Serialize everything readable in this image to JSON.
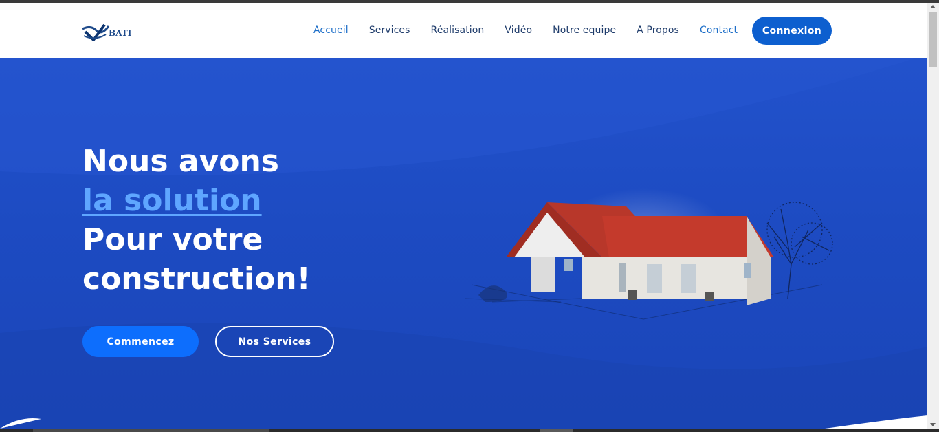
{
  "site": {
    "logo_text": "BATI",
    "logo_icon": "wave-v-logo"
  },
  "nav": {
    "items": [
      {
        "label": "Accueil",
        "active": true
      },
      {
        "label": "Services",
        "active": false
      },
      {
        "label": "Réalisation",
        "active": false
      },
      {
        "label": "Vidéo",
        "active": false
      },
      {
        "label": "Notre equipe",
        "active": false
      },
      {
        "label": "A Propos",
        "active": false
      },
      {
        "label": "Contact",
        "active": false
      }
    ],
    "login_label": "Connexion"
  },
  "hero": {
    "line1": "Nous avons",
    "line2": "la solution",
    "line3": "Pour votre",
    "line4": "construction!",
    "primary_button": "Commencez",
    "secondary_button": "Nos Services",
    "illustration": "house-illustration"
  },
  "colors": {
    "brand_blue": "#0d5fcf",
    "hero_blue": "#1d4bc2",
    "accent_light_blue": "#5fa6ff",
    "nav_text": "#1f3c6b",
    "nav_active": "#1e6fc8"
  }
}
